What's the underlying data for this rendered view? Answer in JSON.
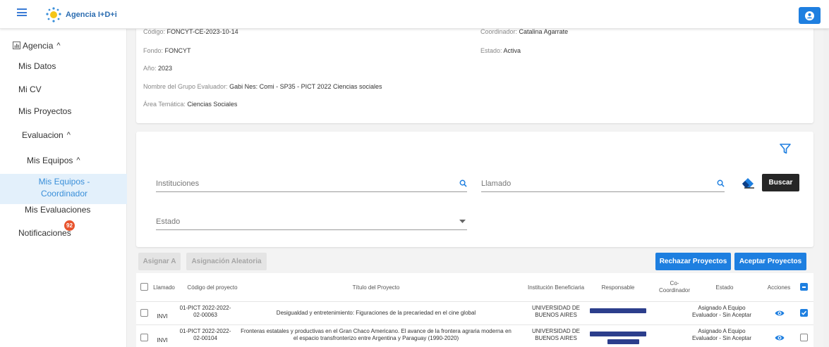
{
  "brand": {
    "name": "Agencia I+D+i"
  },
  "sidebar": {
    "items": [
      {
        "label": "Agencia"
      },
      {
        "label": "Mis Datos"
      },
      {
        "label": "Mi CV"
      },
      {
        "label": "Mis Proyectos"
      },
      {
        "label": "Evaluacion"
      },
      {
        "label": "Mis Equipos"
      },
      {
        "label": "Mis Equipos - Coordinador"
      },
      {
        "label": "Mis Evaluaciones"
      },
      {
        "label": "Notificaciones"
      }
    ],
    "notification_count": "92"
  },
  "info": {
    "codigo_label": "Código:",
    "codigo_value": "FONCYT-CE-2023-10-14",
    "coordinador_label": "Coordinador:",
    "coordinador_value": "Catalina Agarrate",
    "fondo_label": "Fondo:",
    "fondo_value": "FONCYT",
    "estado_label": "Estado:",
    "estado_value": "Activa",
    "anio_label": "Año:",
    "anio_value": "2023",
    "grupo_label": "Nombre del Grupo Evaluador:",
    "grupo_value": "Gabi Nes: Comi - SP35 - PICT 2022 Ciencias sociales",
    "area_label": "Área Temática:",
    "area_value": "Ciencias Sociales"
  },
  "filters": {
    "instituciones": "Instituciones",
    "llamado": "Llamado",
    "estado": "Estado",
    "buscar": "Buscar"
  },
  "actions": {
    "asignar": "Asignar A",
    "aleatoria": "Asignación Aleatoria",
    "rechazar": "Rechazar Proyectos",
    "aceptar": "Aceptar Proyectos"
  },
  "table": {
    "headers": {
      "llamado": "Llamado",
      "codigo": "Código del proyecto",
      "titulo": "Título del Proyecto",
      "institucion": "Institución Beneficiaria",
      "responsable": "Responsable",
      "cocoord_1": "Co-",
      "cocoord_2": "Coordinador",
      "estado": "Estado",
      "acciones": "Acciones"
    },
    "rows": [
      {
        "llamado": "INVI",
        "codigo_1": "01-PICT 2022-2022-",
        "codigo_2": "02-00063",
        "titulo_1": "Desigualdad y entretenimiento: Figuraciones de la precariedad en el cine global",
        "titulo_2": "",
        "inst_1": "UNIVERSIDAD DE",
        "inst_2": "BUENOS AIRES",
        "estado_1": "Asignado A Equipo",
        "estado_2": "Evaluador - Sin Aceptar",
        "checked": true
      },
      {
        "llamado": "INVI",
        "codigo_1": "01-PICT 2022-2022-",
        "codigo_2": "02-00104",
        "titulo_1": "Fronteras estatales y productivas en el Gran Chaco Americano. El avance de la frontera agraria moderna en",
        "titulo_2": "el espacio transfronterizo entre Argentina y Paraguay (1990-2020)",
        "inst_1": "UNIVERSIDAD DE",
        "inst_2": "BUENOS AIRES",
        "estado_1": "Asignado A Equipo",
        "estado_2": "Evaluador - Sin Aceptar",
        "checked": false
      }
    ]
  },
  "colors": {
    "accent": "#1e7fe0",
    "badge": "#e8542e",
    "active_bg": "#e3f0fb",
    "redacted": "#2c3e8c"
  },
  "icons": [
    "menu-icon",
    "agencia-logo-icon",
    "account-icon",
    "dashboard-icon",
    "search-icon",
    "filter-icon",
    "eraser-icon",
    "dropdown-arrow-icon",
    "eye-icon"
  ]
}
